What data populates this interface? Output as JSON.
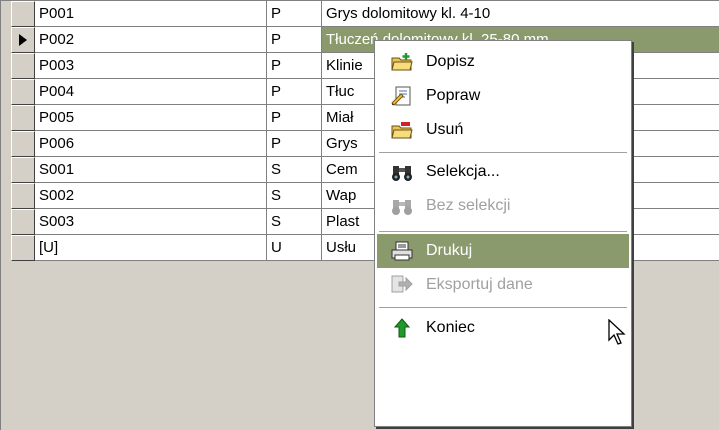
{
  "grid": {
    "selected_row": 1,
    "rows": [
      {
        "code": "P001",
        "type": "P",
        "name": "Grys dolomitowy kl. 4-10"
      },
      {
        "code": "P002",
        "type": "P",
        "name": "Tłuczeń dolomitowy kl. 25-80 mm"
      },
      {
        "code": "P003",
        "type": "P",
        "name": "Klinie"
      },
      {
        "code": "P004",
        "type": "P",
        "name": "Tłuc"
      },
      {
        "code": "P005",
        "type": "P",
        "name": "Miał"
      },
      {
        "code": "P006",
        "type": "P",
        "name": "Grys"
      },
      {
        "code": "S001",
        "type": "S",
        "name": "Cem"
      },
      {
        "code": "S002",
        "type": "S",
        "name": "Wap"
      },
      {
        "code": "S003",
        "type": "S",
        "name": "Plast"
      },
      {
        "code": "[U]",
        "type": "U",
        "name": "Usłu"
      }
    ]
  },
  "context_menu": {
    "items": [
      {
        "label": "Dopisz",
        "icon": "folder-add-icon",
        "enabled": true
      },
      {
        "label": "Popraw",
        "icon": "edit-document-icon",
        "enabled": true
      },
      {
        "label": "Usuń",
        "icon": "folder-delete-icon",
        "enabled": true
      },
      {
        "label": "Selekcja...",
        "icon": "binoculars-icon",
        "enabled": true
      },
      {
        "label": "Bez selekcji",
        "icon": "binoculars-disabled-icon",
        "enabled": false
      },
      {
        "label": "Drukuj",
        "icon": "printer-icon",
        "enabled": true,
        "highlighted": true
      },
      {
        "label": "Eksportuj dane",
        "icon": "export-icon",
        "enabled": false
      },
      {
        "label": "Koniec",
        "icon": "exit-arrow-icon",
        "enabled": true
      }
    ]
  },
  "colors": {
    "selection": "#8b9a6c",
    "grid_lines": "#808080",
    "background": "#d4d0c8"
  }
}
